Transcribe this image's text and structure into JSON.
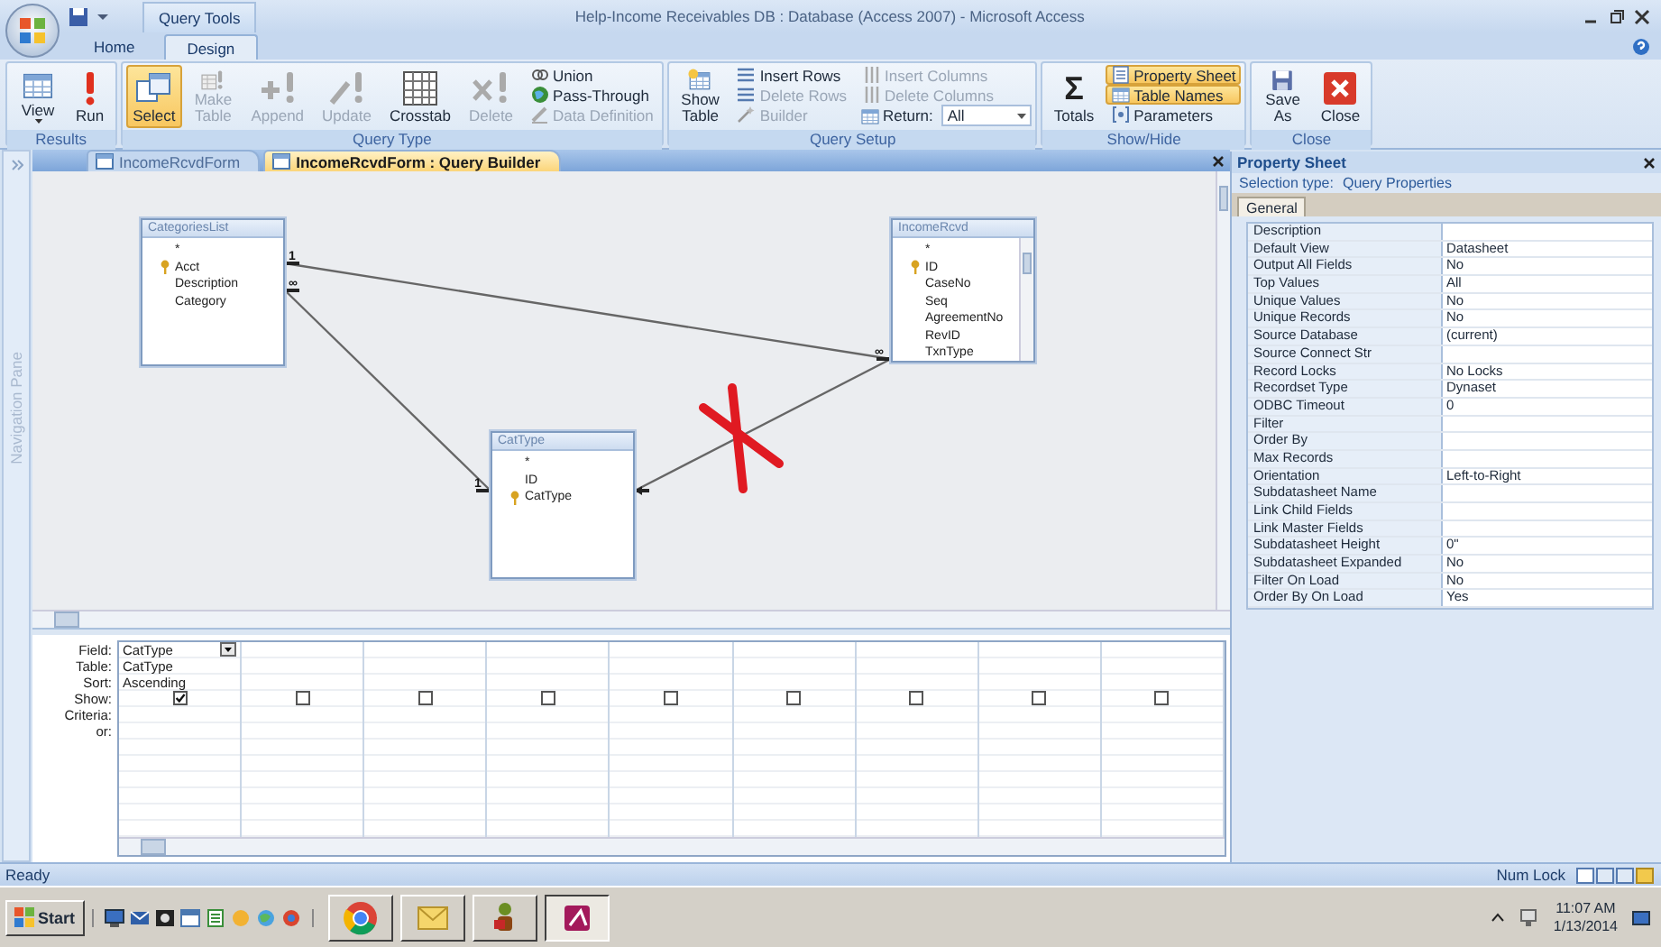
{
  "window": {
    "title": "Help-Income Receivables DB : Database (Access 2007) - Microsoft Access",
    "contextual_tab": "Query Tools"
  },
  "ribbon_tabs": [
    {
      "label": "Home",
      "selected": false
    },
    {
      "label": "Design",
      "selected": true
    }
  ],
  "ribbon_groups": [
    {
      "name": "Results",
      "items": [
        {
          "kind": "large",
          "label": "View",
          "has_menu": true,
          "selected": false,
          "disabled": false
        },
        {
          "kind": "large",
          "label": "Run",
          "selected": false,
          "disabled": false
        }
      ]
    },
    {
      "name": "Query Type",
      "items": [
        {
          "kind": "large",
          "label": "Select",
          "selected": true,
          "disabled": false
        },
        {
          "kind": "large",
          "label": "Make\nTable",
          "selected": false,
          "disabled": true
        },
        {
          "kind": "large",
          "label": "Append",
          "selected": false,
          "disabled": true
        },
        {
          "kind": "large",
          "label": "Update",
          "selected": false,
          "disabled": true
        },
        {
          "kind": "large",
          "label": "Crosstab",
          "selected": false,
          "disabled": false
        },
        {
          "kind": "large",
          "label": "Delete",
          "selected": false,
          "disabled": true
        },
        {
          "kind": "small",
          "label": "Union",
          "selected": false,
          "disabled": false
        },
        {
          "kind": "small",
          "label": "Pass-Through",
          "selected": false,
          "disabled": false
        },
        {
          "kind": "small",
          "label": "Data Definition",
          "selected": false,
          "disabled": true
        }
      ]
    },
    {
      "name": "Query Setup",
      "items": [
        {
          "kind": "large",
          "label": "Show\nTable",
          "selected": false,
          "disabled": false
        },
        {
          "kind": "small",
          "label": "Insert Rows",
          "selected": false,
          "disabled": false
        },
        {
          "kind": "small",
          "label": "Delete Rows",
          "selected": false,
          "disabled": true
        },
        {
          "kind": "small",
          "label": "Builder",
          "selected": false,
          "disabled": true
        },
        {
          "kind": "small",
          "label": "Insert Columns",
          "selected": false,
          "disabled": true
        },
        {
          "kind": "small",
          "label": "Delete Columns",
          "selected": false,
          "disabled": true
        },
        {
          "kind": "combo",
          "label": "Return:",
          "value": "All"
        }
      ]
    },
    {
      "name": "Show/Hide",
      "items": [
        {
          "kind": "large",
          "label": "Totals",
          "glyph": "Σ",
          "selected": false,
          "disabled": false
        },
        {
          "kind": "small",
          "label": "Property Sheet",
          "selected": true,
          "disabled": false
        },
        {
          "kind": "small",
          "label": "Table Names",
          "selected": true,
          "disabled": false
        },
        {
          "kind": "small",
          "label": "Parameters",
          "selected": false,
          "disabled": false
        }
      ]
    },
    {
      "name": "Close",
      "items": [
        {
          "kind": "large",
          "label": "Save\nAs",
          "selected": false,
          "disabled": false
        },
        {
          "kind": "large",
          "label": "Close",
          "selected": false,
          "disabled": false
        }
      ]
    }
  ],
  "navigation_pane": {
    "label": "Navigation Pane"
  },
  "document_tabs": [
    {
      "label": "IncomeRcvdForm",
      "selected": false
    },
    {
      "label": "IncomeRcvdForm : Query Builder",
      "selected": true
    }
  ],
  "tables": [
    {
      "title": "CategoriesList",
      "scrollable": false,
      "fields": [
        {
          "name": "*",
          "key": false
        },
        {
          "name": "Acct",
          "key": true
        },
        {
          "name": "Description",
          "key": false
        },
        {
          "name": "Category",
          "key": false
        }
      ]
    },
    {
      "title": "IncomeRcvd",
      "scrollable": true,
      "fields": [
        {
          "name": "*",
          "key": false
        },
        {
          "name": "ID",
          "key": true
        },
        {
          "name": "CaseNo",
          "key": false
        },
        {
          "name": "Seq",
          "key": false
        },
        {
          "name": "AgreementNo",
          "key": false
        },
        {
          "name": "RevID",
          "key": false
        },
        {
          "name": "TxnType",
          "key": false
        }
      ]
    },
    {
      "title": "CatType",
      "scrollable": false,
      "fields": [
        {
          "name": "*",
          "key": false
        },
        {
          "name": "ID",
          "key": false
        },
        {
          "name": "CatType",
          "key": true
        }
      ]
    }
  ],
  "joins": [
    {
      "from_mark": "1",
      "to_mark": "∞"
    },
    {
      "from_mark": "∞",
      "to_mark": "1"
    },
    {
      "arrow": true
    }
  ],
  "grid": {
    "row_labels": [
      "Field:",
      "Table:",
      "Sort:",
      "Show:",
      "Criteria:",
      "or:"
    ],
    "columns": [
      {
        "field": "CatType",
        "table": "CatType",
        "sort": "Ascending",
        "show": true,
        "focused": true
      },
      {
        "show": false,
        "focused": false
      },
      {
        "show": false,
        "focused": false
      },
      {
        "show": false,
        "focused": false
      },
      {
        "show": false,
        "focused": false
      },
      {
        "show": false,
        "focused": false
      },
      {
        "show": false,
        "focused": false
      },
      {
        "show": false,
        "focused": false
      },
      {
        "show": false,
        "focused": false
      }
    ]
  },
  "property_sheet": {
    "title": "Property Sheet",
    "selection_label": "Selection type:",
    "selection_value": "Query Properties",
    "tabs": [
      {
        "label": "General",
        "selected": true
      }
    ],
    "properties": [
      {
        "name": "Description"
      },
      {
        "name": "Default View",
        "value": "Datasheet"
      },
      {
        "name": "Output All Fields",
        "value": "No"
      },
      {
        "name": "Top Values",
        "value": "All"
      },
      {
        "name": "Unique Values",
        "value": "No"
      },
      {
        "name": "Unique Records",
        "value": "No"
      },
      {
        "name": "Source Database",
        "value": "(current)"
      },
      {
        "name": "Source Connect Str"
      },
      {
        "name": "Record Locks",
        "value": "No Locks"
      },
      {
        "name": "Recordset Type",
        "value": "Dynaset"
      },
      {
        "name": "ODBC Timeout",
        "value": "0"
      },
      {
        "name": "Filter"
      },
      {
        "name": "Order By"
      },
      {
        "name": "Max Records"
      },
      {
        "name": "Orientation",
        "value": "Left-to-Right"
      },
      {
        "name": "Subdatasheet Name"
      },
      {
        "name": "Link Child Fields"
      },
      {
        "name": "Link Master Fields"
      },
      {
        "name": "Subdatasheet Height",
        "value": "0\""
      },
      {
        "name": "Subdatasheet Expanded",
        "value": "No"
      },
      {
        "name": "Filter On Load",
        "value": "No"
      },
      {
        "name": "Order By On Load",
        "value": "Yes"
      }
    ]
  },
  "status_bar": {
    "text": "Ready",
    "indicator": "Num Lock"
  },
  "taskbar": {
    "start": "Start",
    "tasks": [
      {
        "selected": false
      },
      {
        "selected": false
      },
      {
        "selected": false
      },
      {
        "selected": true
      }
    ],
    "time": "11:07 AM",
    "date": "1/13/2014"
  }
}
